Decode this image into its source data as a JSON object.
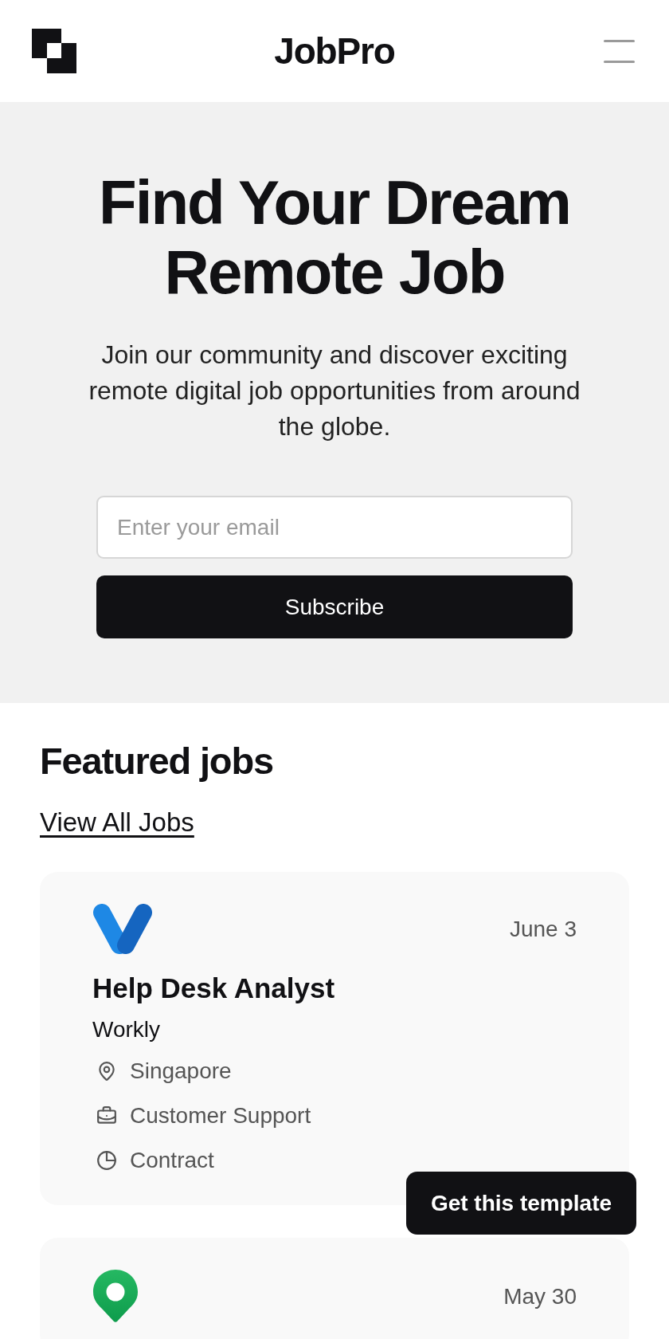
{
  "header": {
    "title": "JobPro"
  },
  "hero": {
    "heading": "Find Your Dream Remote Job",
    "text": "Join our community and discover exciting remote digital job opportunities from around the globe.",
    "email": {
      "placeholder": "Enter your email"
    },
    "button": "Subscribe"
  },
  "featured": {
    "title": "Featured jobs",
    "link": "View All Jobs",
    "jobs": [
      {
        "kind": "v",
        "date": "June 3",
        "title": "Help Desk Analyst",
        "company": "Workly",
        "details": [
          {
            "kind": "location",
            "text": "Singapore"
          },
          {
            "kind": "category",
            "text": "Customer Support"
          },
          {
            "kind": "contract",
            "text": "Contract"
          }
        ]
      },
      {
        "kind": "pin",
        "date": "May 30"
      }
    ]
  },
  "cta": {
    "label": "Get this template"
  }
}
